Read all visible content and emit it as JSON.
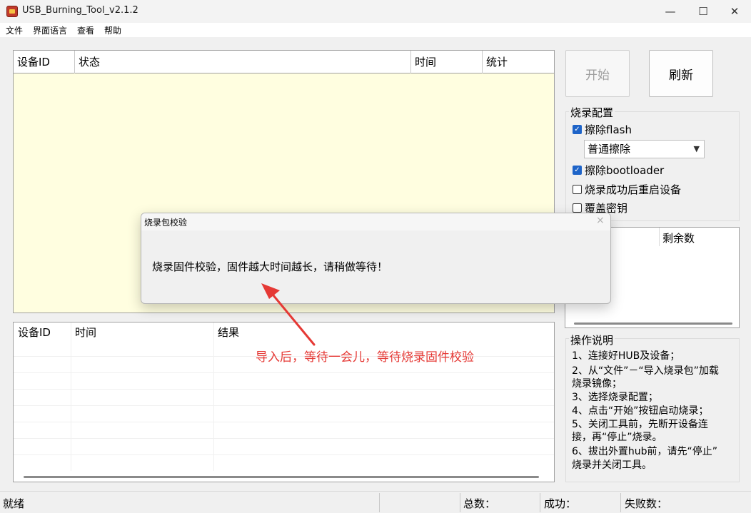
{
  "window": {
    "title": "USB_Burning_Tool_v2.1.2"
  },
  "menu": {
    "file": "文件",
    "language": "界面语言",
    "view": "查看",
    "help": "帮助"
  },
  "device_table": {
    "headers": [
      "设备ID",
      "状态",
      "时间",
      "统计"
    ]
  },
  "result_table": {
    "headers": [
      "设备ID",
      "时间",
      "结果"
    ]
  },
  "buttons": {
    "start": "开始",
    "refresh": "刷新"
  },
  "burn_config": {
    "title": "烧录配置",
    "erase_flash": "擦除flash",
    "erase_flash_checked": true,
    "erase_mode": "普通擦除",
    "erase_bootloader": "擦除bootloader",
    "erase_bootloader_checked": true,
    "reboot_after": "烧录成功后重启设备",
    "reboot_after_checked": false,
    "overwrite_key": "覆盖密钥",
    "overwrite_key_checked": false
  },
  "stats_panel": {
    "remaining_label": "剩余数"
  },
  "instructions": {
    "title": "操作说明",
    "lines": [
      "1、连接好HUB及设备；",
      "2、从“文件”－“导入烧录包”加载",
      "烧录镜像；",
      "3、选择烧录配置；",
      "4、点击“开始”按钮启动烧录；",
      "5、关闭工具前，先断开设备连",
      "接，再“停止”烧录。",
      "6、拔出外置hub前，请先“停止”",
      "烧录并关闭工具。"
    ]
  },
  "status_bar": {
    "ready": "就绪",
    "total": "总数：",
    "success": "成功：",
    "fail": "失败数："
  },
  "dialog": {
    "title": "烧录包校验",
    "message": "烧录固件校验，固件越大时间越长，请稍做等待！",
    "close": "×"
  },
  "annotation": {
    "text": "导入后，等待一会儿，等待烧录固件校验",
    "color": "#e53935"
  },
  "icons": {
    "app": "usb-burning-tool-icon",
    "check": "✓",
    "dropdown": "⌄"
  }
}
